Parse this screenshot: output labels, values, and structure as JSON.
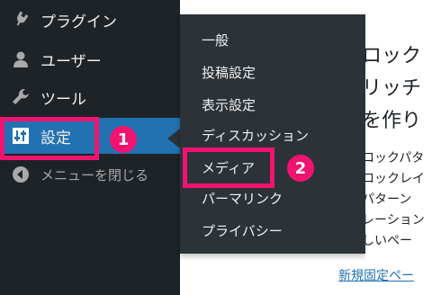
{
  "sidebar": {
    "items": [
      {
        "label": "プラグイン",
        "icon": "plugin-icon"
      },
      {
        "label": "ユーザー",
        "icon": "user-icon"
      },
      {
        "label": "ツール",
        "icon": "wrench-icon"
      },
      {
        "label": "設定",
        "icon": "settings-sliders-icon"
      },
      {
        "label": "メニューを閉じる",
        "icon": "collapse-arrow-icon"
      }
    ]
  },
  "flyout": {
    "items": [
      {
        "label": "一般"
      },
      {
        "label": "投稿設定"
      },
      {
        "label": "表示設定"
      },
      {
        "label": "ディスカッション"
      },
      {
        "label": "メディア"
      },
      {
        "label": "パーマリンク"
      },
      {
        "label": "プライバシー"
      }
    ]
  },
  "callouts": {
    "badge1": "1",
    "badge2": "2",
    "color": "#f0136f"
  },
  "content": {
    "headline_lines": [
      "ロック",
      "リッチ",
      "を作り"
    ],
    "body_lines": [
      "ロックパタ",
      "ロックレイ",
      "パターン",
      "レーション",
      "しいペー"
    ],
    "link": "新規固定ペー"
  },
  "colors": {
    "sidebar_bg": "#1d2327",
    "flyout_bg": "#2c3338",
    "active_bg": "#2271b1"
  }
}
